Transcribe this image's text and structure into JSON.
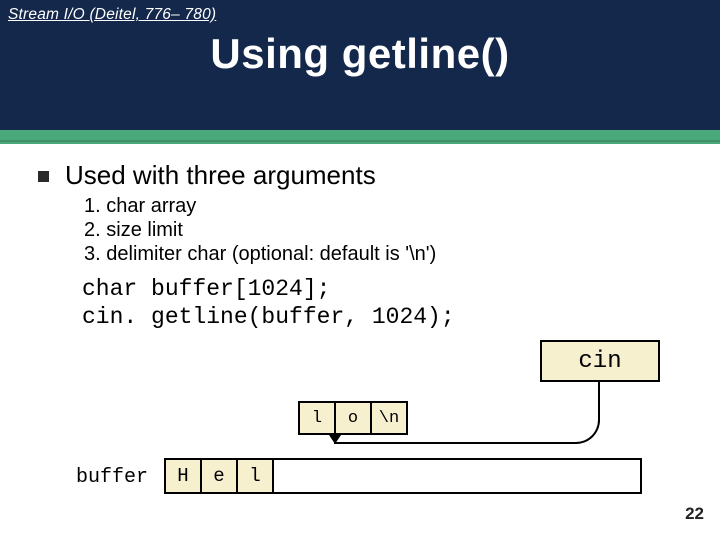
{
  "header": {
    "breadcrumb": "Stream I/O (Deitel, 776– 780)",
    "title": "Using getline()"
  },
  "bullet": "Used with three arguments",
  "args": [
    {
      "n": "1.",
      "text": "char array"
    },
    {
      "n": "2.",
      "text": "size limit"
    },
    {
      "n": "3.",
      "text": "delimiter char (optional: default is '\\n')"
    }
  ],
  "code": {
    "line1": "char buffer[1024];",
    "line2": "cin. getline(buffer, 1024);"
  },
  "cin_label": "cin",
  "stream_cells": [
    "l",
    "o",
    "\\n"
  ],
  "buffer_label": "buffer",
  "buffer_cells": [
    "H",
    "e",
    "l"
  ],
  "page_number": "22"
}
